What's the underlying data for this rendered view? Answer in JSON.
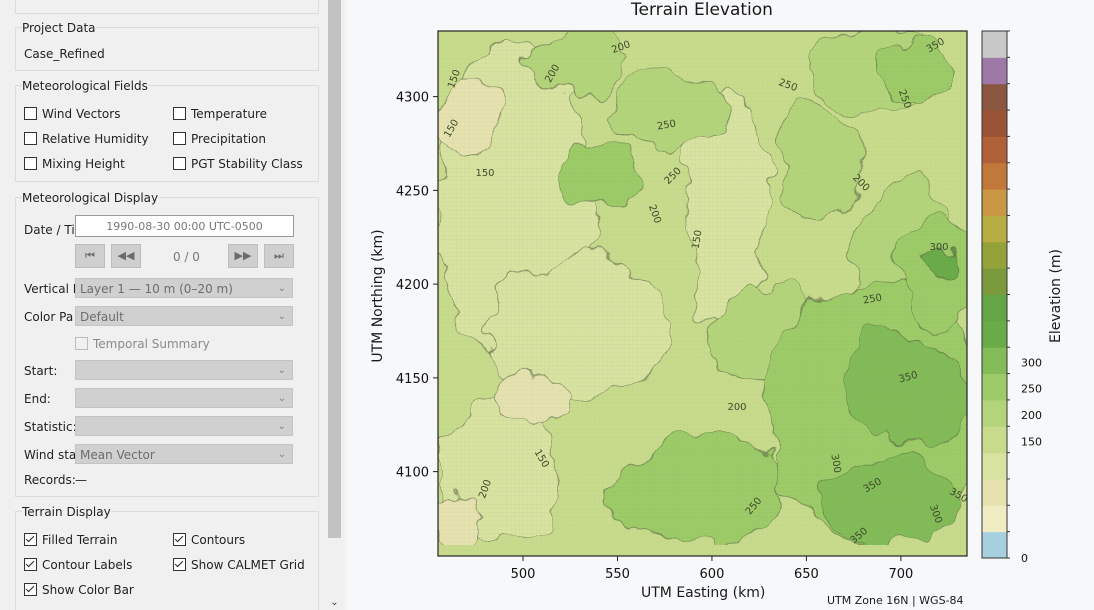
{
  "panel": {
    "project_data": {
      "title": "Project Data",
      "name": "Case_Refined"
    },
    "met_fields": {
      "title": "Meteorological Fields",
      "items": [
        {
          "label": "Wind Vectors",
          "checked": false
        },
        {
          "label": "Temperature",
          "checked": false
        },
        {
          "label": "Relative Humidity",
          "checked": false
        },
        {
          "label": "Precipitation",
          "checked": false
        },
        {
          "label": "Mixing Height",
          "checked": false
        },
        {
          "label": "PGT Stability Class",
          "checked": false
        }
      ]
    },
    "met_display": {
      "title": "Meteorological Display",
      "date_label": "Date / Ti",
      "date_value": "1990-08-30 00:00  UTC-0500",
      "nav": {
        "first": "⏮",
        "prev": "◀◀",
        "counter": "0 / 0",
        "next": "▶▶",
        "last": "⏭"
      },
      "vertical_label": "Vertical L",
      "vertical_value": "Layer 1 — 10 m (0–20 m)",
      "palette_label": "Color Pa",
      "palette_value": "Default",
      "temporal_summary": "Temporal Summary",
      "start_label": "Start:",
      "end_label": "End:",
      "statistic_label": "Statistic:",
      "wind_label": "Wind sta",
      "wind_value": "Mean Vector",
      "records_label": "Records:",
      "records_value": "—"
    },
    "terrain_display": {
      "title": "Terrain Display",
      "items": [
        {
          "label": "Filled Terrain",
          "checked": true
        },
        {
          "label": "Contours",
          "checked": true
        },
        {
          "label": "Contour Labels",
          "checked": true
        },
        {
          "label": "Show CALMET Grid",
          "checked": true
        },
        {
          "label": "Show Color Bar",
          "checked": true
        }
      ]
    }
  },
  "chart_data": {
    "type": "heatmap",
    "title": "Terrain Elevation",
    "xlabel": "UTM Easting (km)",
    "ylabel": "UTM Northing (km)",
    "x_ticks": [
      500,
      550,
      600,
      650,
      700
    ],
    "y_ticks": [
      4100,
      4150,
      4200,
      4250,
      4300
    ],
    "xlim": [
      455,
      735
    ],
    "ylim": [
      4055,
      4335
    ],
    "colorbar_label": "Elevation (m)",
    "colorbar_ticks": [
      0,
      150,
      200,
      250,
      300
    ],
    "colorbar_colors": [
      "#a7d0df",
      "#f0edc4",
      "#e6e2b0",
      "#d8e2a1",
      "#c8db8d",
      "#b4d47b",
      "#9dcb68",
      "#83bb58",
      "#6aab48",
      "#64a548",
      "#7a9a3c",
      "#94a23a",
      "#b7ad42",
      "#c99644",
      "#c2783a",
      "#b0613a",
      "#9a5334",
      "#8a5640",
      "#9e78a6",
      "#c8c8c8"
    ],
    "contour_labels": [
      "150",
      "200",
      "250",
      "300",
      "350"
    ],
    "footer": "UTM Zone 16N | WGS-84"
  }
}
